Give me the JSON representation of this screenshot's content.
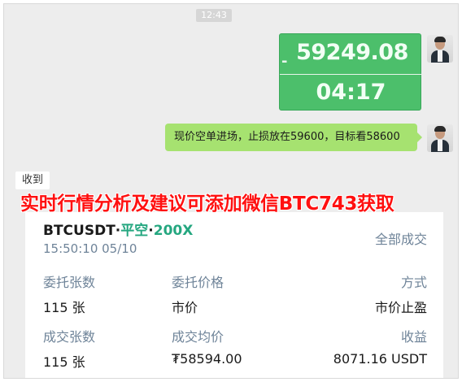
{
  "chat": {
    "timestamp": "12:43",
    "price_message": {
      "dash": "-",
      "price": "59249.08",
      "time": "04:17"
    },
    "text_message": "现价空单进场，止损放在59600，目标看58600",
    "received_label": "收到"
  },
  "banner": {
    "text": "实时行情分析及建议可添加微信BTC743获取",
    "color": "#ff1010"
  },
  "order_card": {
    "symbol": "BTCUSDT",
    "separator": "·",
    "side": "平空",
    "leverage": "200X",
    "side_color": "#25a780",
    "datetime": "15:50:10 05/10",
    "status": "全部成交",
    "row1": {
      "labels": [
        "委托张数",
        "委托价格",
        "方式"
      ],
      "values": [
        "115 张",
        "市价",
        "市价止盈"
      ]
    },
    "row2": {
      "labels": [
        "成交张数",
        "成交均价",
        "收益"
      ],
      "values": [
        "115 张",
        "₮58594.00",
        "8071.16 USDT"
      ]
    }
  },
  "colors": {
    "bubble_green": "#4cbf6b",
    "text_bubble_green": "#a6e270",
    "label_gray": "#6f8499"
  }
}
